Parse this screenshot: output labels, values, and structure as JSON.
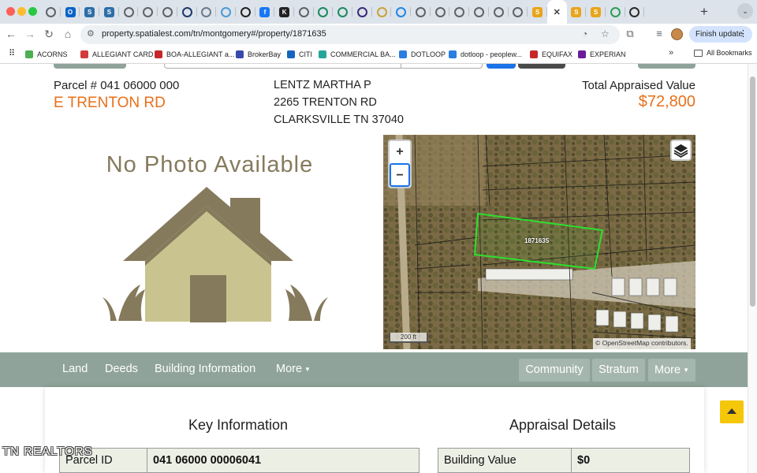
{
  "browser": {
    "url": "property.spatialest.com/tn/montgomery#/property/1871635",
    "finish_update_label": "Finish update",
    "new_tab_label": "+",
    "tabs": [
      {
        "icon": "globe-icon",
        "color": "#5f6368",
        "glyph": ""
      },
      {
        "icon": "outlook-icon",
        "color": "#0a64c8",
        "glyph": "O"
      },
      {
        "icon": "dashboard-icon",
        "color": "#2d6ea8",
        "glyph": "S"
      },
      {
        "icon": "dashboard-icon",
        "color": "#2d6ea8",
        "glyph": "S"
      },
      {
        "icon": "globe-icon",
        "color": "#5f6368",
        "glyph": ""
      },
      {
        "icon": "globe-icon",
        "color": "#5f6368",
        "glyph": ""
      },
      {
        "icon": "globe-icon",
        "color": "#5f6368",
        "glyph": ""
      },
      {
        "icon": "navy-circle-icon",
        "color": "#1b3a6b",
        "glyph": ""
      },
      {
        "icon": "location-icon",
        "color": "#6b7b8c",
        "glyph": ""
      },
      {
        "icon": "smile-icon",
        "color": "#4a9ad8",
        "glyph": ""
      },
      {
        "icon": "link-icon",
        "color": "#222222",
        "glyph": ""
      },
      {
        "icon": "facebook-icon",
        "color": "#1877f2",
        "glyph": "f"
      },
      {
        "icon": "k-logo-icon",
        "color": "#222222",
        "glyph": "K"
      },
      {
        "icon": "circle-logo-icon",
        "color": "#5f6368",
        "glyph": ""
      },
      {
        "icon": "green-logo-icon",
        "color": "#1c8a5c",
        "glyph": ""
      },
      {
        "icon": "green-logo-icon",
        "color": "#1c8a5c",
        "glyph": ""
      },
      {
        "icon": "star-logo-icon",
        "color": "#3b2a7a",
        "glyph": ""
      },
      {
        "icon": "gear-logo-icon",
        "color": "#c7a33a",
        "glyph": ""
      },
      {
        "icon": "blue-dot-icon",
        "color": "#1e88e5",
        "glyph": ""
      },
      {
        "icon": "speaker-icon",
        "color": "#5f6368",
        "glyph": ""
      },
      {
        "icon": "globe-icon",
        "color": "#5f6368",
        "glyph": ""
      },
      {
        "icon": "globe-icon",
        "color": "#5f6368",
        "glyph": ""
      },
      {
        "icon": "globe-icon",
        "color": "#5f6368",
        "glyph": ""
      },
      {
        "icon": "globe-icon",
        "color": "#5f6368",
        "glyph": ""
      },
      {
        "icon": "globe-icon",
        "color": "#5f6368",
        "glyph": ""
      },
      {
        "icon": "spatialest-icon",
        "color": "#e8a41a",
        "glyph": "S"
      },
      {
        "icon": "close-icon",
        "color": "#3c4043",
        "glyph": "✕",
        "active": true
      },
      {
        "icon": "spatialest-icon",
        "color": "#e8a41a",
        "glyph": "S"
      },
      {
        "icon": "spatialest-icon",
        "color": "#e8a41a",
        "glyph": "S"
      },
      {
        "icon": "chrome-icon",
        "color": "#2e9d5a",
        "glyph": ""
      },
      {
        "icon": "dark-circle-icon",
        "color": "#2a2a2a",
        "glyph": ""
      }
    ],
    "bookmarks": [
      {
        "label": "ACORNS",
        "color": "#4caf50"
      },
      {
        "label": "ALLEGIANT CARD",
        "color": "#d33b3b"
      },
      {
        "label": "BOA-ALLEGIANT a...",
        "color": "#c62828"
      },
      {
        "label": "BrokerBay",
        "color": "#3949ab"
      },
      {
        "label": "CITI",
        "color": "#1565c0"
      },
      {
        "label": "COMMERCIAL BA...",
        "color": "#26a69a"
      },
      {
        "label": "DOTLOOP",
        "color": "#2a7de1"
      },
      {
        "label": "dotloop - peoplew...",
        "color": "#2a7de1"
      },
      {
        "label": "EQUIFAX",
        "color": "#c62828"
      },
      {
        "label": "EXPERIAN",
        "color": "#6a1b9a"
      }
    ],
    "all_bookmarks_label": "All Bookmarks",
    "more_bookmarks_label": "»"
  },
  "property": {
    "parcel_label": "Parcel # 041 06000 000",
    "street": "E TRENTON RD",
    "owner": "LENTZ MARTHA P",
    "address_line1": "2265 TRENTON RD",
    "address_line2": "CLARKSVILLE TN 37040",
    "appraised_label": "Total Appraised Value",
    "appraised_value": "$72,800"
  },
  "photo": {
    "no_photo_text": "No Photo Available"
  },
  "map": {
    "zoom_in": "+",
    "zoom_out": "−",
    "parcel_id": "1871635",
    "scale_label": "200 ft",
    "attribution": "© OpenStreetMap contributors.",
    "layers_icon": "layers-icon",
    "parcel_outline_color": "#2ee02e"
  },
  "nav": {
    "left": [
      "Land",
      "Deeds",
      "Building Information",
      "More"
    ],
    "right": [
      "Community",
      "Stratum",
      "More"
    ],
    "bar_color": "#8fa39a"
  },
  "key_info": {
    "title": "Key Information",
    "row_label": "Parcel ID",
    "row_value": "041 06000 00006041"
  },
  "appraisal": {
    "title": "Appraisal Details",
    "row_label": "Building Value",
    "row_value": "$0"
  },
  "watermark": "TN REALTORS",
  "colors": {
    "accent_orange": "#e8701a",
    "scroll_top_yellow": "#f5c70a"
  }
}
